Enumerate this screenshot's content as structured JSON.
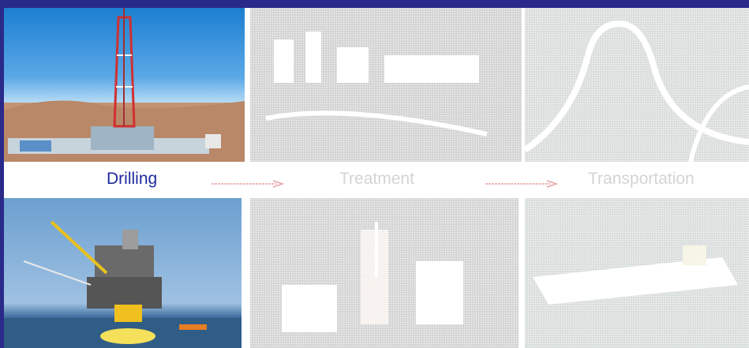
{
  "steps": [
    {
      "label": "Drilling",
      "active": true
    },
    {
      "label": "Treatment",
      "active": false
    },
    {
      "label": "Transportation",
      "active": false
    }
  ],
  "panels": {
    "drilling_rig": "desert-drilling-rig-image",
    "offshore_platform": "offshore-platform-image",
    "treatment_plant": "treatment-facility-image",
    "treatment_equipment": "treatment-equipment-image",
    "pipeline": "pipeline-image",
    "tanker": "tanker-image"
  },
  "colors": {
    "brand": "#2a2a8a",
    "active_label": "#1e2a9e",
    "inactive_label": "#c8c8c8",
    "arrow": "#e8a4a4"
  }
}
